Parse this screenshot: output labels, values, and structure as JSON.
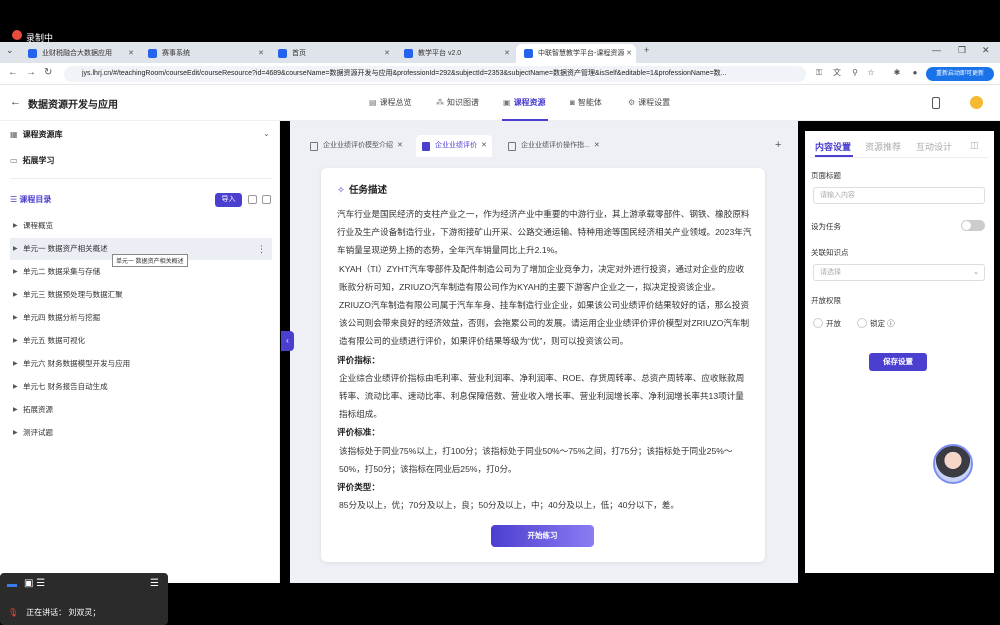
{
  "recording": {
    "label": "录制中"
  },
  "browser": {
    "tabs": [
      {
        "label": "业财税融合大数据应用"
      },
      {
        "label": "赛事系统"
      },
      {
        "label": "首页"
      },
      {
        "label": "教学平台 v2.0"
      },
      {
        "label": "中联智慧教学平台-课程资源"
      }
    ],
    "url": "jys.lhrj.cn/#/teachingRoom/courseEdit/courseResource?id=4689&courseName=数据资源开发与应用&professionId=292&subjectId=2353&subjectName=数据资产管理&isSelf&editable=1&professionName=数...",
    "restart_label": "重新启动即可更新"
  },
  "app": {
    "title": "数据资源开发与应用",
    "nav": [
      {
        "label": "课程总览",
        "icon": "book-icon"
      },
      {
        "label": "知识图谱",
        "icon": "graph-icon"
      },
      {
        "label": "课程资源",
        "icon": "resource-icon"
      },
      {
        "label": "智能体",
        "icon": "agent-icon"
      },
      {
        "label": "课程设置",
        "icon": "gear-icon"
      }
    ]
  },
  "left": {
    "library": "课程资源库",
    "extend": "拓展学习",
    "catalog": "课程目录",
    "import": "导入",
    "items": [
      {
        "label": "课程概览"
      },
      {
        "label": "单元一 数据资产相关概述"
      },
      {
        "label": "单元二 数据采集与存储"
      },
      {
        "label": "单元三 数据预处理与数据汇聚"
      },
      {
        "label": "单元四 数据分析与挖掘"
      },
      {
        "label": "单元五 数据可视化"
      },
      {
        "label": "单元六 财务数据模型开发与应用"
      },
      {
        "label": "单元七 财务报告自动生成"
      },
      {
        "label": "拓展资源"
      },
      {
        "label": "测评试题"
      }
    ],
    "tooltip": "单元一 数据资产相关概述"
  },
  "center": {
    "tabs": [
      {
        "label": "企业业绩评价模型介绍"
      },
      {
        "label": "企业业绩评价"
      },
      {
        "label": "企业业绩评价操作指..."
      }
    ],
    "task_title": "任务描述",
    "p1": "汽车行业是国民经济的支柱产业之一，作为经济产业中重要的中游行业，其上游承载零部件、钢铁、橡胶原料行业及生产设备制造行业，下游衔接矿山开采、公路交通运输、特种用途等国民经济相关产业领域。2023年汽车销量呈现逆势上扬的态势，全年汽车销量同比上升2.1%。",
    "p2": "KYAH（TI）ZYHT汽车零部件及配件制造公司为了增加企业竞争力，决定对外进行投资，通过对企业的应收账款分析可知，ZRIUZO汽车制造有限公司作为KYAH的主要下游客户企业之一，拟决定投资该企业。ZRIUZO汽车制造有限公司属于汽车车身、挂车制造行业企业，如果该公司业绩评价结果较好的话，那么投资该公司则会带来良好的经济效益，否则，会拖累公司的发展。请运用企业业绩评价评价模型对ZRIUZO汽车制造有限公司的业绩进行评价，如果评价结果等级为“优”，则可以投资该公司。",
    "h1": "评价指标：",
    "p3": "企业综合业绩评价指标由毛利率、营业利润率、净利润率、ROE、存货周转率、总资产周转率、应收账款周转率、流动比率、速动比率、利息保障倍数、营业收入增长率、营业利润增长率、净利润增长率共13项计量指标组成。",
    "h2": "评价标准：",
    "p4": "该指标处于同业75%以上，打100分；该指标处于同业50%～75%之间，打75分；该指标处于同业25%～50%，打50分；该指标在同业后25%，打0分。",
    "h3": "评价类型：",
    "p5": "85分及以上，优；70分及以上，良；50分及以上，中；40分及以上，低；40分以下，差。",
    "start": "开始练习"
  },
  "right": {
    "tabs": [
      "内容设置",
      "资源推荐",
      "互动设计"
    ],
    "page_title_label": "页面标题",
    "page_title_placeholder": "请输入内容",
    "set_task": "设为任务",
    "knowledge_label": "关联知识点",
    "knowledge_placeholder": "请选择",
    "open_label": "开放权限",
    "open": "开放",
    "lock": "锁定",
    "save": "保存设置"
  },
  "meeting": {
    "speaking_label": "正在讲话：",
    "speaker": "刘双灵；"
  },
  "colors": {
    "accent": "#4b3fcf",
    "recording": "#e74c3c"
  }
}
